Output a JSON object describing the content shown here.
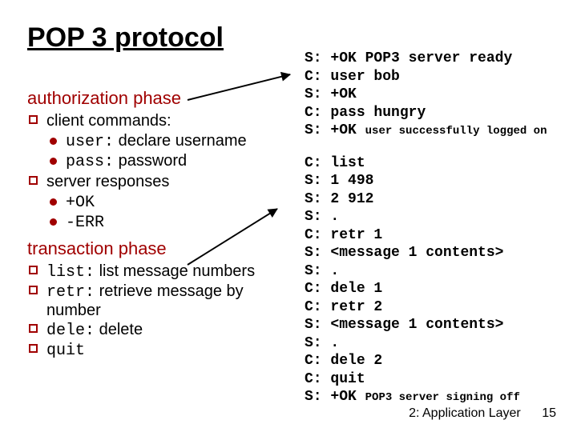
{
  "title": "POP 3 protocol",
  "sections": {
    "auth": {
      "heading": "authorization phase",
      "items": [
        {
          "text": "client commands:",
          "sub": [
            {
              "code": "user:",
              "after": " declare username"
            },
            {
              "code": "pass:",
              "after": " password"
            }
          ]
        },
        {
          "text": "server responses",
          "sub": [
            {
              "code": "+OK",
              "after": ""
            },
            {
              "code": "-ERR",
              "after": ""
            }
          ]
        }
      ]
    },
    "trans": {
      "heading": "transaction phase",
      "items": [
        {
          "code": "list:",
          "after": " list message numbers"
        },
        {
          "code": "retr:",
          "after": " retrieve message by number"
        },
        {
          "code": "dele:",
          "after": " delete"
        },
        {
          "code": "quit",
          "after": ""
        }
      ]
    }
  },
  "session": {
    "block1": [
      {
        "p": "S:",
        "t": "+OK POP3 server ready"
      },
      {
        "p": "C:",
        "t": "user bob"
      },
      {
        "p": "S:",
        "t": "+OK"
      },
      {
        "p": "C:",
        "t": "pass hungry"
      },
      {
        "p": "S:",
        "t": "+OK ",
        "small": "user successfully logged on"
      }
    ],
    "block2": [
      {
        "p": "C:",
        "t": "list"
      },
      {
        "p": "S:",
        "t": "1 498"
      },
      {
        "p": "S:",
        "t": "2 912"
      },
      {
        "p": "S:",
        "t": "."
      },
      {
        "p": "C:",
        "t": "retr 1"
      },
      {
        "p": "S:",
        "t": "<message 1 contents>"
      },
      {
        "p": "S:",
        "t": "."
      },
      {
        "p": "C:",
        "t": "dele 1"
      },
      {
        "p": "C:",
        "t": "retr 2"
      },
      {
        "p": "S:",
        "t": "<message 1 contents>"
      },
      {
        "p": "S:",
        "t": "."
      },
      {
        "p": "C:",
        "t": "dele 2"
      },
      {
        "p": "C:",
        "t": "quit"
      },
      {
        "p": "S:",
        "t": "+OK ",
        "small": "POP3 server signing off"
      }
    ]
  },
  "footer": {
    "chapter": "2: Application Layer",
    "page": "15"
  }
}
